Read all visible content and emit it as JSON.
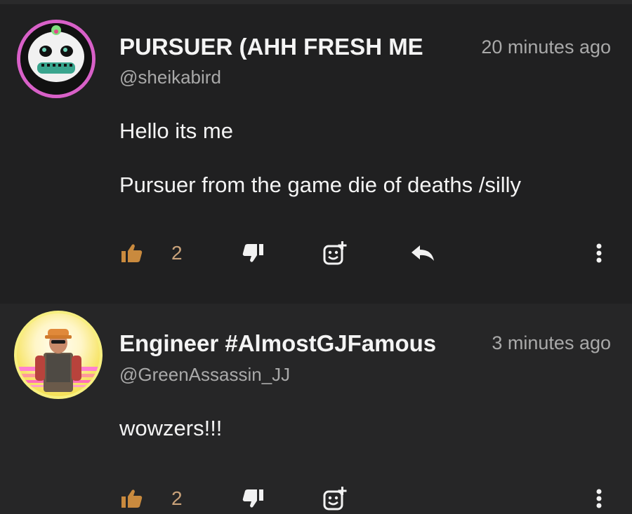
{
  "colors": {
    "like_accent": "#c98a3e",
    "muted_text": "#a9a9a9",
    "avatar_ring_1": "#d860c8",
    "avatar_ring_2": "#f7ef80"
  },
  "comments": [
    {
      "author": "PURSUER (AHH FRESH ME",
      "handle": "@sheikabird",
      "timestamp": "20 minutes ago",
      "body": [
        "Hello its me",
        "Pursuer from the game die of deaths /silly"
      ],
      "likes": "2",
      "actions": [
        "like-icon",
        "dislike-icon",
        "add-reaction-icon",
        "reply-icon",
        "more-options-icon"
      ]
    },
    {
      "author": "Engineer #AlmostGJFamous",
      "handle": "@GreenAssassin_JJ",
      "timestamp": "3 minutes ago",
      "body": [
        "wowzers!!!"
      ],
      "likes": "2",
      "actions": [
        "like-icon",
        "dislike-icon",
        "add-reaction-icon",
        "more-options-icon"
      ]
    }
  ]
}
